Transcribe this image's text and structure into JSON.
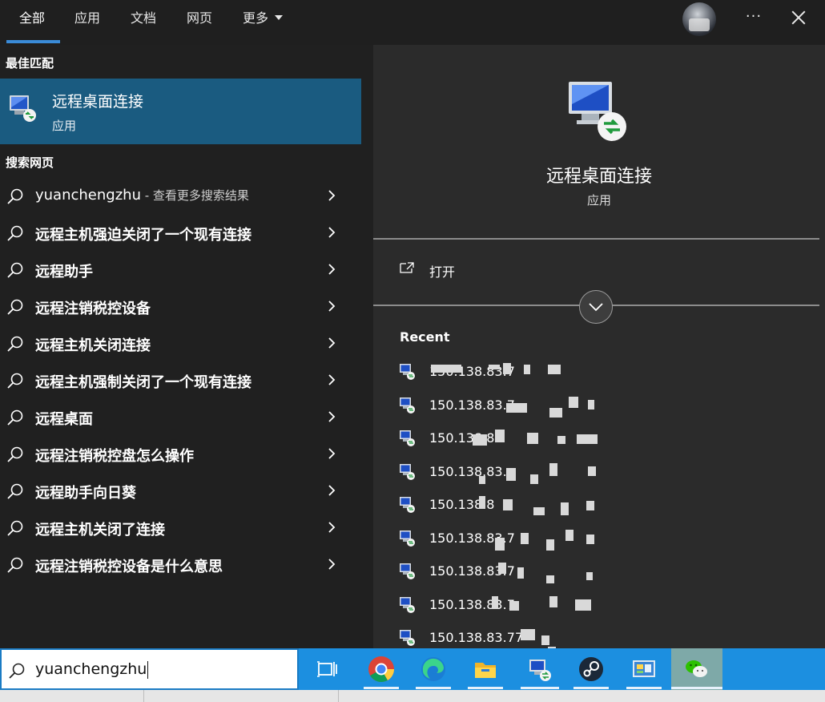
{
  "tabs": [
    {
      "label": "全部",
      "active": true
    },
    {
      "label": "应用",
      "active": false
    },
    {
      "label": "文档",
      "active": false
    },
    {
      "label": "网页",
      "active": false
    },
    {
      "label": "更多",
      "active": false
    }
  ],
  "topbar": {
    "more_label": "···"
  },
  "left": {
    "best_match_title": "最佳匹配",
    "best_match": {
      "name": "远程桌面连接",
      "type": "应用",
      "icon": "remote-desktop-icon"
    },
    "web_title": "搜索网页",
    "suggestions": [
      {
        "text": "yuanchengzhu",
        "tail": " - 查看更多搜索结果"
      },
      {
        "text": "远程主机强迫关闭了一个现有连接"
      },
      {
        "text": "远程助手"
      },
      {
        "text": "远程注销税控设备"
      },
      {
        "text": "远程主机关闭连接"
      },
      {
        "text": "远程主机强制关闭了一个现有连接"
      },
      {
        "text": "远程桌面"
      },
      {
        "text": "远程注销税控盘怎么操作"
      },
      {
        "text": "远程助手向日葵"
      },
      {
        "text": "远程主机关闭了连接"
      },
      {
        "text": "远程注销税控设备是什么意思"
      }
    ]
  },
  "right": {
    "app_name": "远程桌面连接",
    "app_type": "应用",
    "open_label": "打开",
    "recent_title": "Recent",
    "recent": [
      {
        "text": "150.138.83.7"
      },
      {
        "text": "150.138.83.7"
      },
      {
        "text": "150.138.8"
      },
      {
        "text": "150.138.83."
      },
      {
        "text": "150.138.8"
      },
      {
        "text": "150.138.83.7"
      },
      {
        "text": "150.138.83.7"
      },
      {
        "text": "150.138.83.7"
      },
      {
        "text": "150.138.83.77"
      }
    ]
  },
  "taskbar": {
    "search_query": "yuanchengzhu",
    "icons": [
      "task-view-icon",
      "chrome-icon",
      "edge-icon",
      "file-explorer-icon",
      "remote-desktop-icon",
      "steam-icon",
      "control-panel-icon",
      "wechat-icon"
    ]
  },
  "colors": {
    "accent": "#1a5b80",
    "taskbar": "#1c8fe0",
    "panel": "#2b2b2b",
    "bg": "#202020"
  }
}
